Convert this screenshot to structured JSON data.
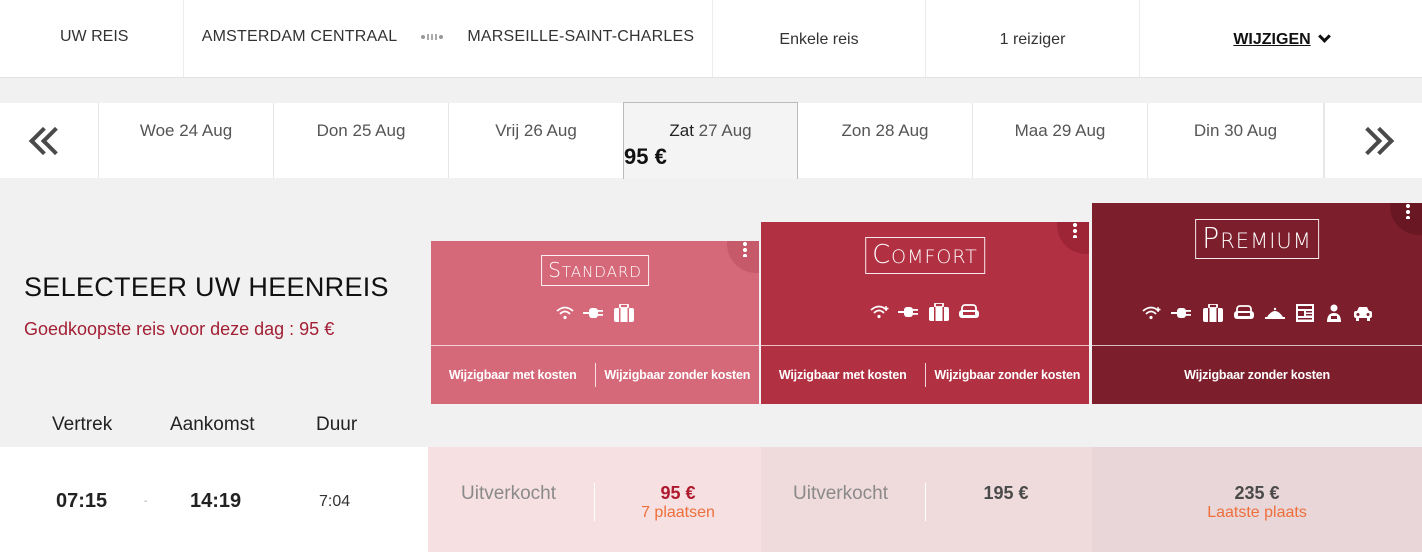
{
  "summary": {
    "label": "UW REIS",
    "origin": "AMSTERDAM CENTRAAL",
    "destination": "MARSEILLE-SAINT-CHARLES",
    "trip_type": "Enkele reis",
    "travellers": "1 reiziger",
    "edit_label": "WIJZIGEN"
  },
  "dates": [
    {
      "dow": "Woe",
      "num": "24 Aug",
      "price": ""
    },
    {
      "dow": "Don",
      "num": "25 Aug",
      "price": ""
    },
    {
      "dow": "Vrij",
      "num": "26 Aug",
      "price": ""
    },
    {
      "dow": "Zat",
      "num": "27 Aug",
      "price": "95 €",
      "selected": true
    },
    {
      "dow": "Zon",
      "num": "28 Aug",
      "price": ""
    },
    {
      "dow": "Maa",
      "num": "29 Aug",
      "price": ""
    },
    {
      "dow": "Din",
      "num": "30 Aug",
      "price": ""
    }
  ],
  "heading": {
    "title": "SELECTEER UW HEENREIS",
    "cheapest": "Goedkoopste reis voor deze dag : 95 €"
  },
  "columns": {
    "departure": "Vertrek",
    "arrival": "Aankomst",
    "duration": "Duur"
  },
  "classes": {
    "standard": {
      "title_first": "S",
      "title_rest": "TANDARD",
      "options": [
        "Wijzigbaar met kosten",
        "Wijzigbaar zonder kosten"
      ],
      "color": "#d5697a"
    },
    "comfort": {
      "title_first": "C",
      "title_rest": "OMFORT",
      "options": [
        "Wijzigbaar met kosten",
        "Wijzigbaar zonder kosten"
      ],
      "color": "#b13042"
    },
    "premium": {
      "title_first": "P",
      "title_rest": "REMIUM",
      "options": [
        "Wijzigbaar zonder kosten"
      ],
      "color": "#7c1e2c"
    }
  },
  "journey": {
    "departure": "07:15",
    "separator": "-",
    "arrival": "14:19",
    "duration": "7:04",
    "standard": {
      "sold_out": "Uitverkocht",
      "price": "95 €",
      "seats": "7 plaatsen"
    },
    "comfort": {
      "sold_out": "Uitverkocht",
      "price": "195 €"
    },
    "premium": {
      "price": "235 €",
      "seats": "Laatste plaats"
    }
  },
  "colors": {
    "accent_red": "#a32035",
    "price_standard": "#b01a2e",
    "price_dark": "#4a4a4a",
    "seats_orange": "#ef6f3a"
  }
}
